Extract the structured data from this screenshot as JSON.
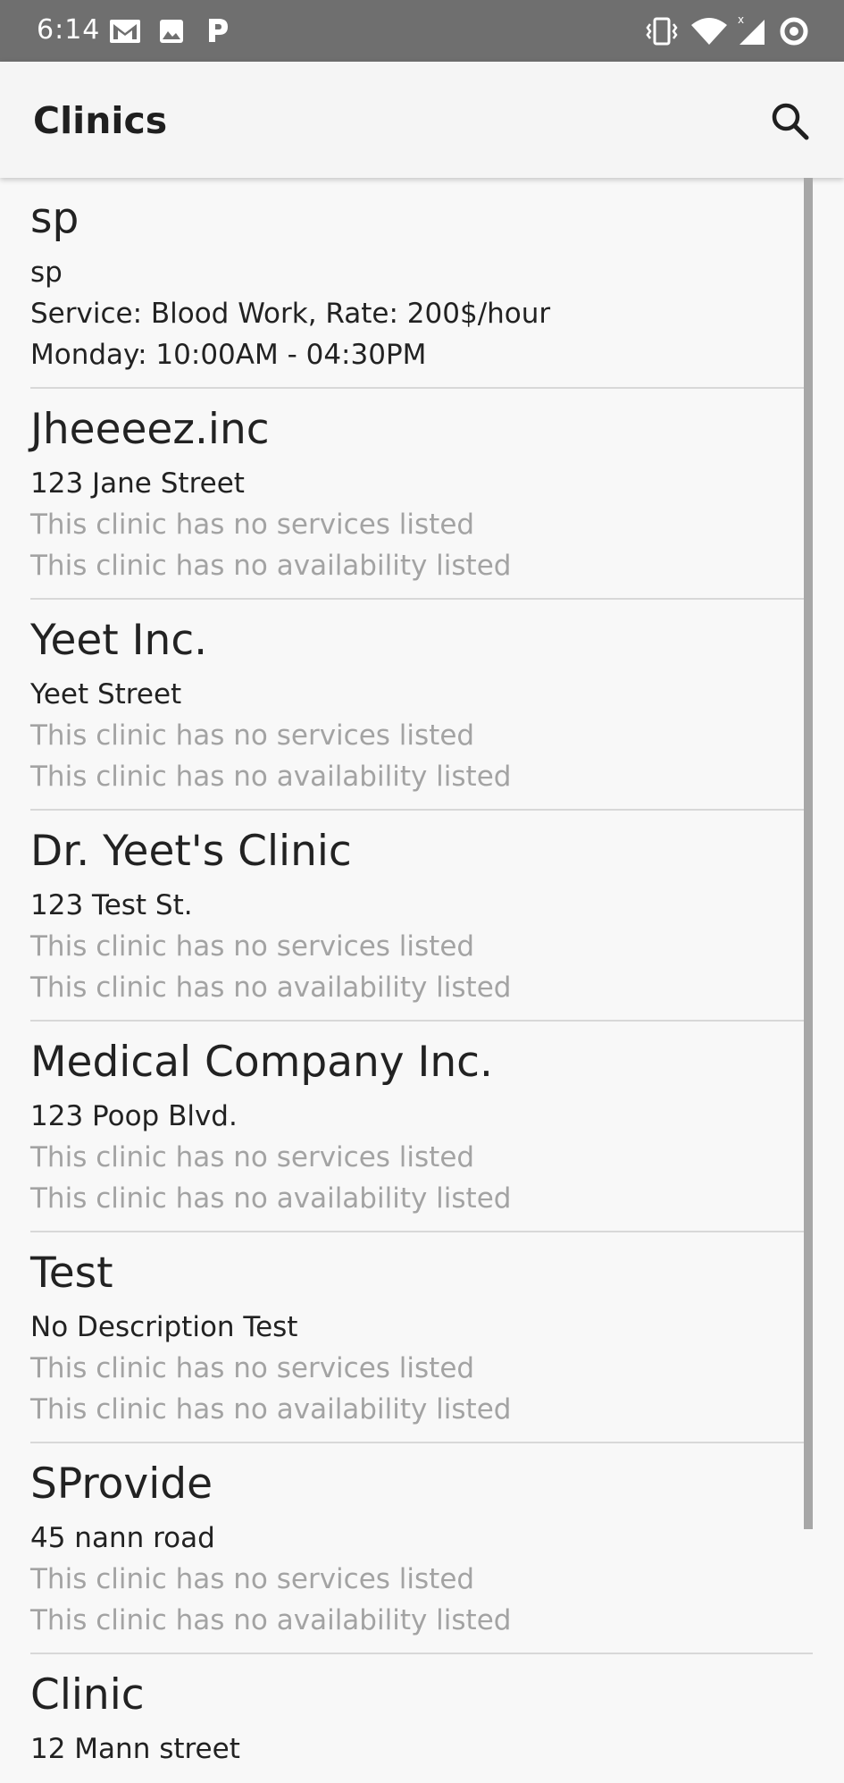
{
  "status_bar": {
    "time": "6:14",
    "left_icons": [
      "gmail-icon",
      "gallery-icon",
      "p-app-icon"
    ],
    "right_icons": [
      "vibrate-icon",
      "wifi-icon",
      "signal-icon",
      "sync-icon"
    ]
  },
  "app_bar": {
    "title": "Clinics",
    "search_icon": "search-icon"
  },
  "clinics": [
    {
      "name": "sp",
      "description": "sp",
      "services": "Service: Blood Work, Rate: 200$/hour",
      "availability": "Monday: 10:00AM - 04:30PM",
      "has_services": true,
      "has_availability": true
    },
    {
      "name": "Jheeeez.inc",
      "description": "123 Jane Street",
      "services": "This clinic has no services listed",
      "availability": "This clinic has no availability listed",
      "has_services": false,
      "has_availability": false
    },
    {
      "name": "Yeet Inc.",
      "description": "Yeet Street",
      "services": "This clinic has no services listed",
      "availability": "This clinic has no availability listed",
      "has_services": false,
      "has_availability": false
    },
    {
      "name": "Dr. Yeet's Clinic",
      "description": "123 Test St.",
      "services": "This clinic has no services listed",
      "availability": "This clinic has no availability listed",
      "has_services": false,
      "has_availability": false
    },
    {
      "name": "Medical Company Inc.",
      "description": "123 Poop Blvd.",
      "services": "This clinic has no services listed",
      "availability": "This clinic has no availability listed",
      "has_services": false,
      "has_availability": false
    },
    {
      "name": "Test",
      "description": "No Description Test",
      "services": "This clinic has no services listed",
      "availability": "This clinic has no availability listed",
      "has_services": false,
      "has_availability": false
    },
    {
      "name": "SProvide",
      "description": "45 nann road",
      "services": "This clinic has no services listed",
      "availability": "This clinic has no availability listed",
      "has_services": false,
      "has_availability": false
    },
    {
      "name": "Clinic",
      "description": "12 Mann street",
      "services": "",
      "availability": "",
      "has_services": false,
      "has_availability": false
    }
  ],
  "colors": {
    "status_bar": "#6f6f6f",
    "app_bar": "#f5f5f5",
    "background": "#f8f8f8",
    "primary_text": "#222222",
    "muted_text": "#a3a3a3",
    "divider": "#d8d8d8",
    "scrollbar": "#a7a7a7"
  }
}
